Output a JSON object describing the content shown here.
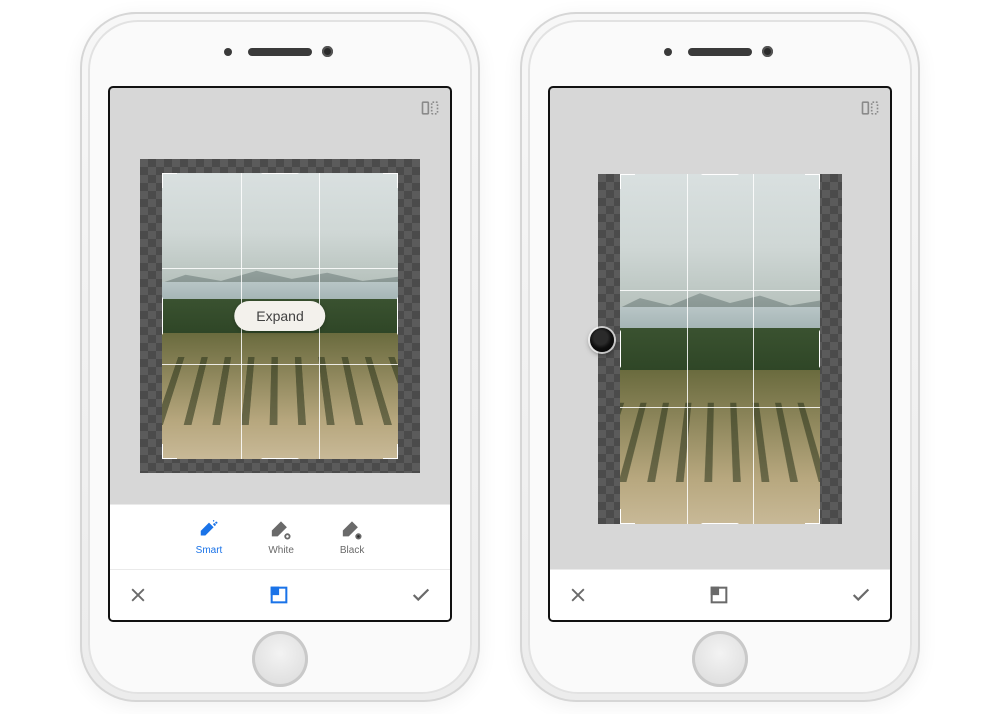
{
  "left": {
    "topbar": {
      "flip_icon": "flip-horizontal"
    },
    "expand_button": {
      "label": "Expand"
    },
    "fill_options": [
      {
        "key": "smart",
        "label": "Smart",
        "active": true
      },
      {
        "key": "white",
        "label": "White",
        "active": false
      },
      {
        "key": "black",
        "label": "Black",
        "active": false
      }
    ],
    "bottom": {
      "cancel_icon": "close",
      "tool_icon": "expand-crop",
      "tool_active": true,
      "confirm_icon": "check"
    }
  },
  "right": {
    "topbar": {
      "flip_icon": "flip-horizontal"
    },
    "lens_overlay": true,
    "bottom": {
      "cancel_icon": "close",
      "tool_icon": "expand-crop",
      "tool_active": false,
      "confirm_icon": "check"
    }
  }
}
